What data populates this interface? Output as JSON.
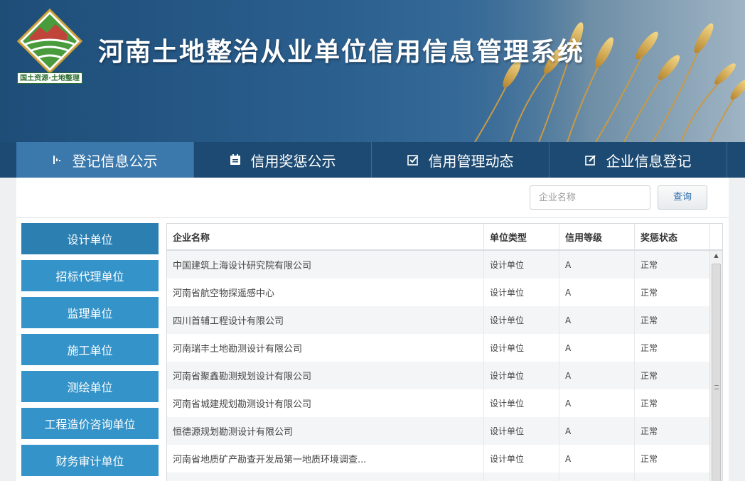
{
  "header": {
    "title": "河南土地整治从业单位信用信息管理系统",
    "logo_caption": "国土资源·土地整理"
  },
  "nav": {
    "items": [
      {
        "label": "登记信息公示",
        "icon": "chart-icon",
        "active": true
      },
      {
        "label": "信用奖惩公示",
        "icon": "document-list-icon",
        "active": false
      },
      {
        "label": "信用管理动态",
        "icon": "checkbox-icon",
        "active": false
      },
      {
        "label": "企业信息登记",
        "icon": "edit-icon",
        "active": false
      }
    ]
  },
  "search": {
    "placeholder": "企业名称",
    "button_label": "查询"
  },
  "sidebar": {
    "items": [
      {
        "label": "设计单位",
        "active": true
      },
      {
        "label": "招标代理单位"
      },
      {
        "label": "监理单位"
      },
      {
        "label": "施工单位"
      },
      {
        "label": "测绘单位"
      },
      {
        "label": "工程造价咨询单位"
      },
      {
        "label": "财务审计单位"
      }
    ]
  },
  "table": {
    "headers": [
      "企业名称",
      "单位类型",
      "信用等级",
      "奖惩状态"
    ],
    "rows": [
      [
        "中国建筑上海设计研究院有限公司",
        "设计单位",
        "A",
        "正常"
      ],
      [
        "河南省航空物探遥感中心",
        "设计单位",
        "A",
        "正常"
      ],
      [
        "四川首辅工程设计有限公司",
        "设计单位",
        "A",
        "正常"
      ],
      [
        "河南瑞丰土地勘测设计有限公司",
        "设计单位",
        "A",
        "正常"
      ],
      [
        "河南省聚鑫勘测规划设计有限公司",
        "设计单位",
        "A",
        "正常"
      ],
      [
        "河南省城建规划勘测设计有限公司",
        "设计单位",
        "A",
        "正常"
      ],
      [
        "恒德源规划勘测设计有限公司",
        "设计单位",
        "A",
        "正常"
      ],
      [
        "河南省地质矿产勘查开发局第一地质环境调查...",
        "设计单位",
        "A",
        "正常"
      ],
      [
        "",
        "",
        "",
        ""
      ]
    ]
  },
  "colors": {
    "header_bg": "#1e4d78",
    "nav_bg": "#1d4a72",
    "nav_active": "#3b78ab",
    "sidebar_item": "#3493c8"
  }
}
